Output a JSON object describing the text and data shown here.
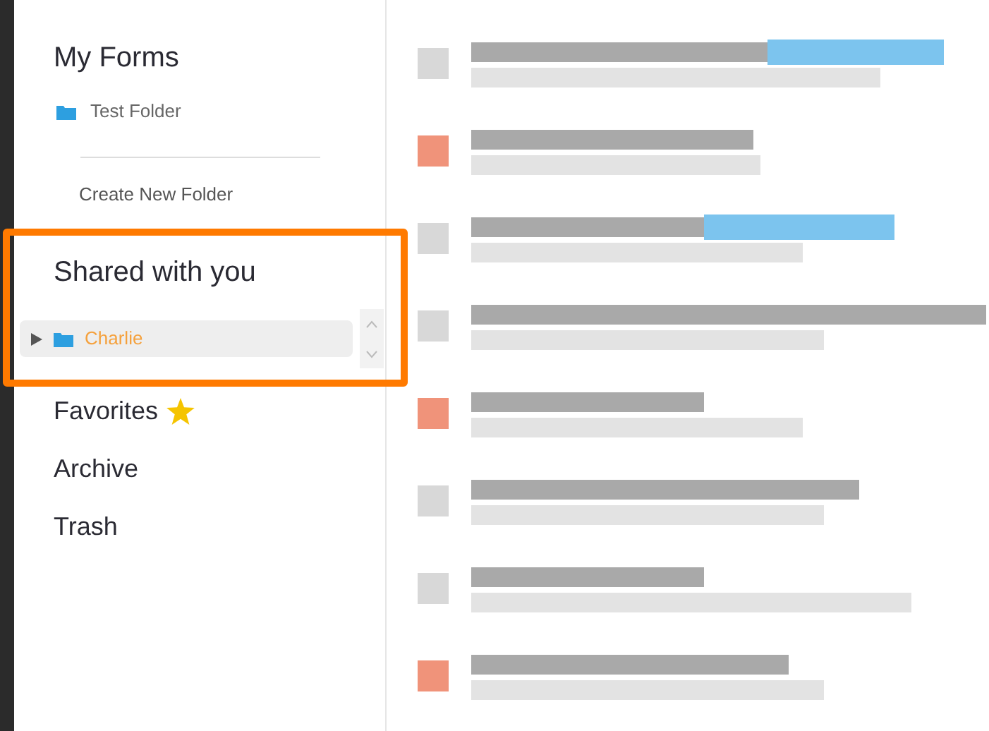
{
  "my_forms": {
    "title": "My Forms",
    "folders": [
      {
        "label": "Test Folder"
      }
    ],
    "create_link": "Create New Folder"
  },
  "shared": {
    "title": "Shared with you",
    "highlighted": true,
    "folders": [
      {
        "label": "Charlie",
        "selected": true,
        "expanded": false
      }
    ]
  },
  "nav": [
    {
      "label": "Favorites",
      "starred": true
    },
    {
      "label": "Archive",
      "starred": false
    },
    {
      "label": "Trash",
      "starred": false
    }
  ]
}
